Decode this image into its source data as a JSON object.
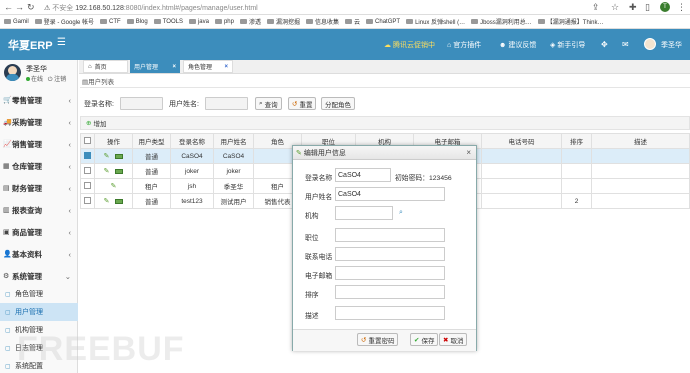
{
  "browser": {
    "security": "不安全",
    "url_host": "192.168.50.128",
    "url_rest": ":8080/index.html#/pages/manage/user.html",
    "profile_initial": "T",
    "bookmarks": [
      "Gamil",
      "登录 - Google 帐号",
      "CTF",
      "Blog",
      "TOOLS",
      "java",
      "php",
      "渗透",
      "漏洞挖掘",
      "信息收集",
      "云",
      "ChatGPT",
      "Linux 反弹shell (…",
      "Jboss漏洞利用总…",
      "【漏洞通报】Think…"
    ]
  },
  "header": {
    "logo": "华夏ERP",
    "items": [
      "腾讯云促销中",
      "官方插件",
      "建议反馈",
      "新手引导"
    ],
    "user": "季圣华"
  },
  "sidebar": {
    "user_name": "季圣华",
    "status_online": "在线",
    "logout": "注销",
    "menus": [
      {
        "label": "零售管理",
        "icon": "cart-icon"
      },
      {
        "label": "采购管理",
        "icon": "truck-icon"
      },
      {
        "label": "销售管理",
        "icon": "sales-icon"
      },
      {
        "label": "仓库管理",
        "icon": "warehouse-icon"
      },
      {
        "label": "财务管理",
        "icon": "finance-icon"
      },
      {
        "label": "报表查询",
        "icon": "report-icon"
      },
      {
        "label": "商品管理",
        "icon": "goods-icon"
      },
      {
        "label": "基本资料",
        "icon": "profile-icon"
      },
      {
        "label": "系统管理",
        "icon": "settings-icon"
      }
    ],
    "submenus": [
      "角色管理",
      "用户管理",
      "机构管理",
      "日志管理",
      "系统配置"
    ]
  },
  "tabs": [
    {
      "label": "首页"
    },
    {
      "label": "用户管理"
    },
    {
      "label": "角色管理"
    }
  ],
  "panel": {
    "title": "用户列表",
    "login_label": "登录名称:",
    "username_label": "用户姓名:",
    "search": "查询",
    "reset": "重置",
    "assign_role": "分配角色",
    "add": "增加"
  },
  "table": {
    "headers": [
      "操作",
      "用户类型",
      "登录名称",
      "用户姓名",
      "角色",
      "职位",
      "机构",
      "电子邮箱",
      "电话号码",
      "排序",
      "描述"
    ],
    "rows": [
      {
        "type": "普通",
        "login": "CaSO4",
        "name": "CaSO4",
        "role": "",
        "position": "",
        "org": "",
        "email": "",
        "phone": "",
        "sort": "",
        "desc": "",
        "selected": true
      },
      {
        "type": "普通",
        "login": "joker",
        "name": "joker",
        "role": "",
        "position": "",
        "org": "",
        "email": "",
        "phone": "",
        "sort": "",
        "desc": "",
        "selected": false
      },
      {
        "type": "租户",
        "login": "jsh",
        "name": "季圣华",
        "role": "租户",
        "position": "",
        "org": "",
        "email": "",
        "phone": "",
        "sort": "",
        "desc": "",
        "selected": false
      },
      {
        "type": "普通",
        "login": "test123",
        "name": "测试用户",
        "role": "销售代表",
        "position": "",
        "org": "",
        "email": "",
        "phone": "",
        "sort": "2",
        "desc": "",
        "selected": false
      }
    ]
  },
  "dialog": {
    "title": "编辑用户信息",
    "login_label": "登录名称",
    "login_value": "CaSO4",
    "init_pwd": "初始密码：123456",
    "name_label": "用户姓名",
    "name_value": "CaSO4",
    "org_label": "机构",
    "position_label": "职位",
    "phone_label": "联系电话",
    "email_label": "电子邮箱",
    "sort_label": "排序",
    "desc_label": "描述",
    "reset_pwd": "重置密码",
    "save": "保存",
    "cancel": "取消"
  },
  "watermark": "FREEBUF",
  "colors": {
    "primary": "#3c8dbc",
    "selected_row": "#dcedf9"
  }
}
